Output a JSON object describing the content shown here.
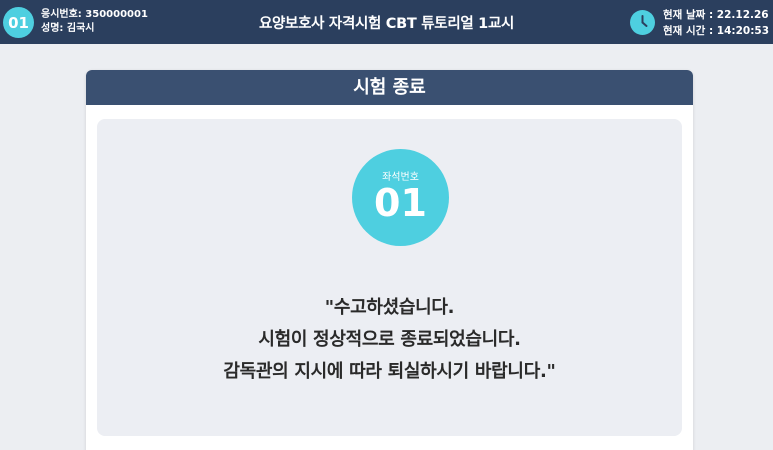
{
  "header": {
    "seat_badge": "01",
    "exam_id_text": "응시번호: 350000001",
    "name_text": "성명: 김국시",
    "title": "요양보호사 자격시험 CBT 튜토리얼 1교시",
    "date_text": "현재 날짜 : 22.12.26",
    "time_text": "현재 시간 : 14:20:53",
    "icons": {
      "clock": "clock-icon"
    }
  },
  "panel": {
    "title": "시험 종료",
    "seat_label": "좌석번호",
    "seat_number": "01",
    "message_lines": [
      "\"수고하셨습니다.",
      "시험이 정상적으로 종료되었습니다.",
      "감독관의 지시에 따라 퇴실하시기 바랍니다.\""
    ]
  },
  "colors": {
    "header_bg": "#2b3f5e",
    "panel_header_bg": "#3a5071",
    "accent": "#4ecfe0",
    "page_bg": "#eceef2"
  }
}
